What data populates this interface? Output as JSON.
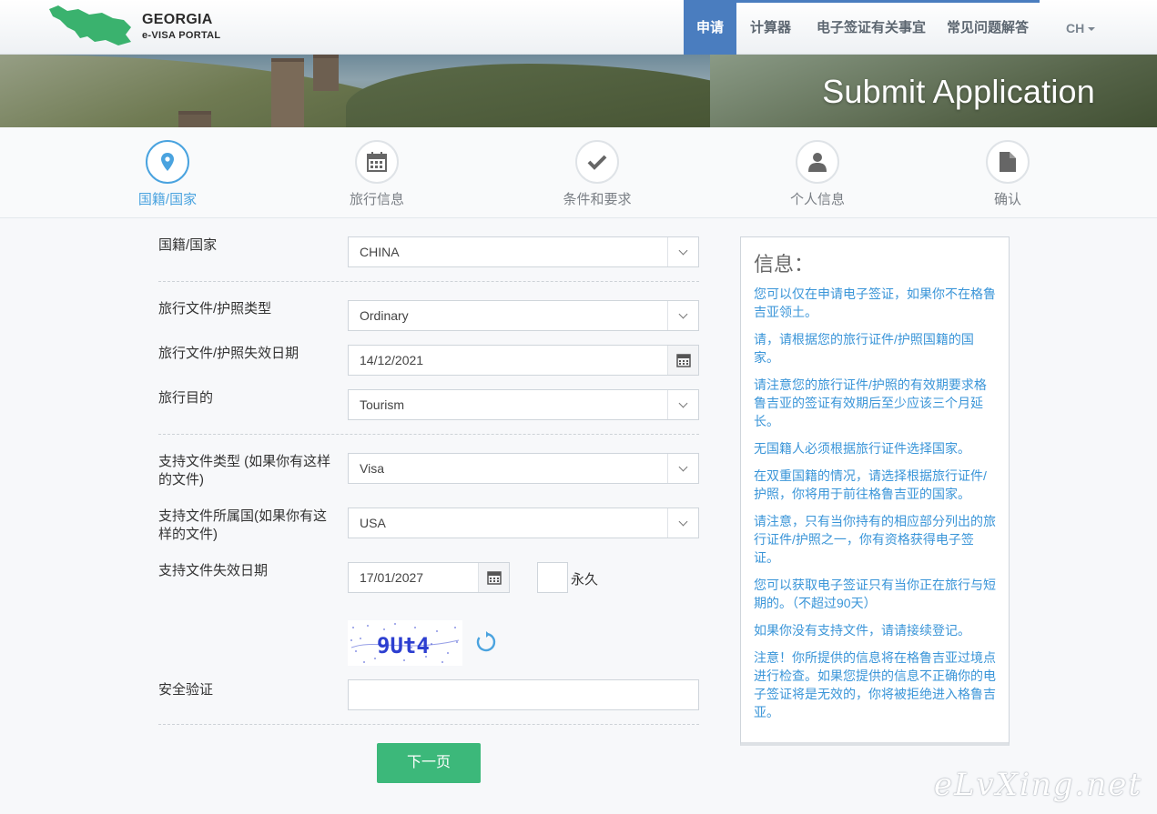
{
  "header": {
    "logo_title": "GEORGIA",
    "logo_subtitle": "e-VISA PORTAL",
    "nav": [
      "申请",
      "计算器",
      "电子签证有关事宜",
      "常见问题解答"
    ],
    "language": "CH"
  },
  "banner": {
    "title": "Submit Application"
  },
  "steps": [
    {
      "label": "国籍/国家",
      "icon": "map-marker-icon",
      "active": true
    },
    {
      "label": "旅行信息",
      "icon": "calendar-icon",
      "active": false
    },
    {
      "label": "条件和要求",
      "icon": "checkmark-icon",
      "active": false
    },
    {
      "label": "个人信息",
      "icon": "user-icon",
      "active": false
    },
    {
      "label": "确认",
      "icon": "document-icon",
      "active": false
    }
  ],
  "form": {
    "nationality_label": "国籍/国家",
    "nationality_value": "CHINA",
    "doc_type_label": "旅行文件/护照类型",
    "doc_type_value": "Ordinary",
    "doc_expiry_label": "旅行文件/护照失效日期",
    "doc_expiry_value": "14/12/2021",
    "purpose_label": "旅行目的",
    "purpose_value": "Tourism",
    "support_type_label": "支持文件类型 (如果你有这样的文件)",
    "support_type_value": "Visa",
    "support_country_label": "支持文件所属国(如果你有这样的文件)",
    "support_country_value": "USA",
    "support_expiry_label": "支持文件失效日期",
    "support_expiry_value": "17/01/2027",
    "permanent_label": "永久",
    "captcha_text": "9Ut4",
    "security_label": "安全验证",
    "security_value": "",
    "next_button": "下一页"
  },
  "info": {
    "title": "信息：",
    "paragraphs": [
      "您可以仅在申请电子签证，如果你不在格鲁吉亚领土。",
      "请，请根据您的旅行证件/护照国籍的国家。",
      "请注意您的旅行证件/护照的有效期要求格鲁吉亚的签证有效期后至少应该三个月延长。",
      "无国籍人必须根据旅行证件选择国家。",
      "在双重国籍的情况，请选择根据旅行证件/护照，你将用于前往格鲁吉亚的国家。",
      "请注意，只有当你持有的相应部分列出的旅行证件/护照之一，你有资格获得电子签证。",
      "您可以获取电子签证只有当你正在旅行与短期的。（不超过90天）",
      "如果你没有支持文件，请请接续登记。",
      "注意！你所提供的信息将在格鲁吉亚过境点进行检查。如果您提供的信息不正确你的电子签证将是无效的，你将被拒绝进入格鲁吉亚。"
    ]
  },
  "watermark": "eLvXing.net",
  "colors": {
    "accent": "#4a7dbf",
    "step_active": "#4aa3df",
    "info_text": "#3a95d8",
    "button": "#3cb87a"
  }
}
